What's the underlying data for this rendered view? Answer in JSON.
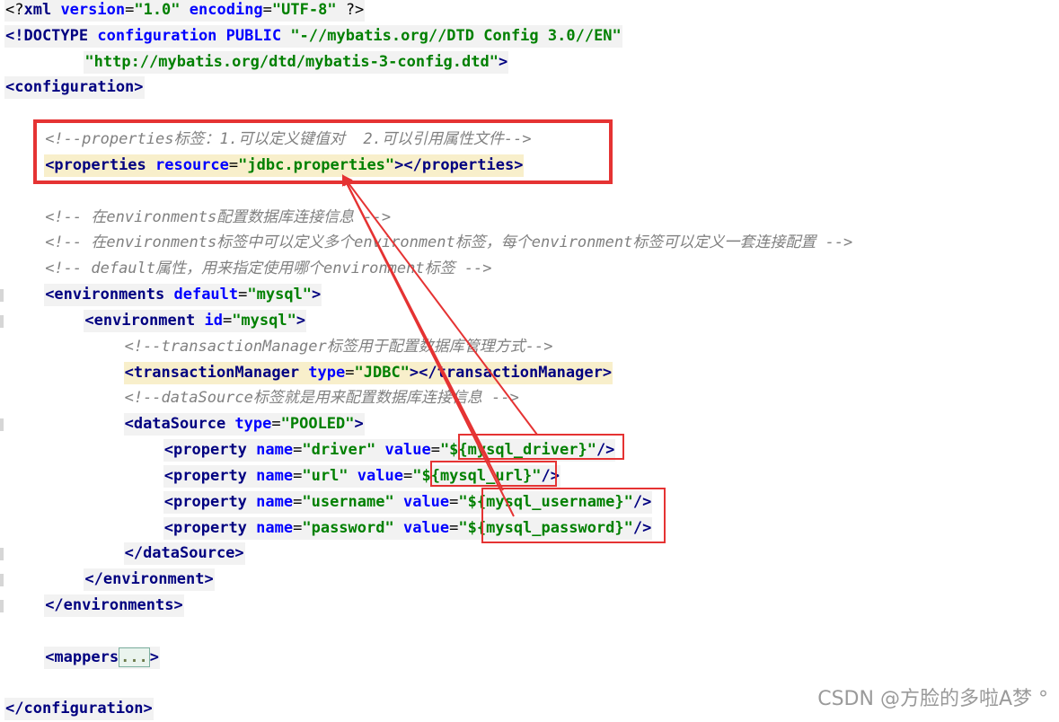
{
  "editor": {
    "lines": [
      {
        "indent": 0,
        "hl": "grey",
        "tokens": [
          {
            "t": "<?",
            "c": "pt"
          },
          {
            "t": "xml ",
            "c": "tb"
          },
          {
            "t": "version",
            "c": "an"
          },
          {
            "t": "=",
            "c": "pt"
          },
          {
            "t": "\"1.0\"",
            "c": "av"
          },
          {
            "t": " ",
            "c": "pt"
          },
          {
            "t": "encoding",
            "c": "an"
          },
          {
            "t": "=",
            "c": "pt"
          },
          {
            "t": "\"UTF-8\"",
            "c": "av"
          },
          {
            "t": " ?>",
            "c": "pt"
          }
        ]
      },
      {
        "indent": 0,
        "hl": "grey",
        "tokens": [
          {
            "t": "<!DOCTYPE ",
            "c": "tb"
          },
          {
            "t": "configuration ",
            "c": "an"
          },
          {
            "t": "PUBLIC ",
            "c": "an"
          },
          {
            "t": "\"-//mybatis.org//DTD Config 3.0//EN\"",
            "c": "av"
          }
        ]
      },
      {
        "indent": 8,
        "hl": "grey",
        "tokens": [
          {
            "t": "\"http://mybatis.org/dtd/mybatis-3-config.dtd\"",
            "c": "av"
          },
          {
            "t": ">",
            "c": "tb"
          }
        ]
      },
      {
        "indent": 0,
        "hl": "grey",
        "tokens": [
          {
            "t": "<configuration>",
            "c": "tb"
          }
        ]
      },
      {
        "indent": 0,
        "hl": "none",
        "tokens": []
      },
      {
        "indent": 4,
        "hl": "none",
        "tokens": [
          {
            "t": "<!--properties标签：1.可以定义键值对  2.可以引用属性文件-->",
            "c": "cm"
          }
        ]
      },
      {
        "indent": 4,
        "hl": "yellow",
        "tokens": [
          {
            "t": "<properties ",
            "c": "tb"
          },
          {
            "t": "resource",
            "c": "an"
          },
          {
            "t": "=",
            "c": "pt"
          },
          {
            "t": "\"jdbc.properties\"",
            "c": "av"
          },
          {
            "t": "></properties>",
            "c": "tb"
          }
        ]
      },
      {
        "indent": 0,
        "hl": "none",
        "tokens": []
      },
      {
        "indent": 4,
        "hl": "none",
        "tokens": [
          {
            "t": "<!-- 在environments配置数据库连接信息 -->",
            "c": "cm"
          }
        ]
      },
      {
        "indent": 4,
        "hl": "none",
        "tokens": [
          {
            "t": "<!-- 在environments标签中可以定义多个environment标签，每个environment标签可以定义一套连接配置 -->",
            "c": "cm"
          }
        ]
      },
      {
        "indent": 4,
        "hl": "none",
        "tokens": [
          {
            "t": "<!-- default属性，用来指定使用哪个environment标签 -->",
            "c": "cm"
          }
        ]
      },
      {
        "indent": 4,
        "hl": "grey",
        "tokens": [
          {
            "t": "<environments ",
            "c": "tb"
          },
          {
            "t": "default",
            "c": "an"
          },
          {
            "t": "=",
            "c": "pt"
          },
          {
            "t": "\"mysql\"",
            "c": "av"
          },
          {
            "t": ">",
            "c": "tb"
          }
        ]
      },
      {
        "indent": 8,
        "hl": "grey",
        "tokens": [
          {
            "t": "<environment ",
            "c": "tb"
          },
          {
            "t": "id",
            "c": "an"
          },
          {
            "t": "=",
            "c": "pt"
          },
          {
            "t": "\"mysql\"",
            "c": "av"
          },
          {
            "t": ">",
            "c": "tb"
          }
        ]
      },
      {
        "indent": 12,
        "hl": "none",
        "tokens": [
          {
            "t": "<!--transactionManager标签用于配置数据库管理方式-->",
            "c": "cm"
          }
        ]
      },
      {
        "indent": 12,
        "hl": "yellow",
        "tokens": [
          {
            "t": "<transactionManager ",
            "c": "tb"
          },
          {
            "t": "type",
            "c": "an"
          },
          {
            "t": "=",
            "c": "pt"
          },
          {
            "t": "\"JDBC\"",
            "c": "av"
          },
          {
            "t": "></transactionManager>",
            "c": "tb"
          }
        ]
      },
      {
        "indent": 12,
        "hl": "none",
        "tokens": [
          {
            "t": "<!--dataSource标签就是用来配置数据库连接信息 -->",
            "c": "cm"
          }
        ]
      },
      {
        "indent": 12,
        "hl": "grey",
        "tokens": [
          {
            "t": "<dataSource ",
            "c": "tb"
          },
          {
            "t": "type",
            "c": "an"
          },
          {
            "t": "=",
            "c": "pt"
          },
          {
            "t": "\"POOLED\"",
            "c": "av"
          },
          {
            "t": ">",
            "c": "tb"
          }
        ]
      },
      {
        "indent": 16,
        "hl": "grey",
        "tokens": [
          {
            "t": "<property ",
            "c": "tb"
          },
          {
            "t": "name",
            "c": "an"
          },
          {
            "t": "=",
            "c": "pt"
          },
          {
            "t": "\"driver\"",
            "c": "av"
          },
          {
            "t": " ",
            "c": "pt"
          },
          {
            "t": "value",
            "c": "an"
          },
          {
            "t": "=",
            "c": "pt"
          },
          {
            "t": "\"${mysql_driver}\"",
            "c": "av"
          },
          {
            "t": "/>",
            "c": "tb"
          }
        ]
      },
      {
        "indent": 16,
        "hl": "grey",
        "tokens": [
          {
            "t": "<property ",
            "c": "tb"
          },
          {
            "t": "name",
            "c": "an"
          },
          {
            "t": "=",
            "c": "pt"
          },
          {
            "t": "\"url\"",
            "c": "av"
          },
          {
            "t": " ",
            "c": "pt"
          },
          {
            "t": "value",
            "c": "an"
          },
          {
            "t": "=",
            "c": "pt"
          },
          {
            "t": "\"${mysql_url}\"",
            "c": "av"
          },
          {
            "t": "/>",
            "c": "tb"
          }
        ]
      },
      {
        "indent": 16,
        "hl": "grey",
        "tokens": [
          {
            "t": "<property ",
            "c": "tb"
          },
          {
            "t": "name",
            "c": "an"
          },
          {
            "t": "=",
            "c": "pt"
          },
          {
            "t": "\"username\"",
            "c": "av"
          },
          {
            "t": " ",
            "c": "pt"
          },
          {
            "t": "value",
            "c": "an"
          },
          {
            "t": "=",
            "c": "pt"
          },
          {
            "t": "\"${mysql_username}\"",
            "c": "av"
          },
          {
            "t": "/>",
            "c": "tb"
          }
        ]
      },
      {
        "indent": 16,
        "hl": "grey",
        "tokens": [
          {
            "t": "<property ",
            "c": "tb"
          },
          {
            "t": "name",
            "c": "an"
          },
          {
            "t": "=",
            "c": "pt"
          },
          {
            "t": "\"password\"",
            "c": "av"
          },
          {
            "t": " ",
            "c": "pt"
          },
          {
            "t": "value",
            "c": "an"
          },
          {
            "t": "=",
            "c": "pt"
          },
          {
            "t": "\"${mysql_password}\"",
            "c": "av"
          },
          {
            "t": "/>",
            "c": "tb"
          }
        ]
      },
      {
        "indent": 12,
        "hl": "grey",
        "tokens": [
          {
            "t": "</dataSource>",
            "c": "tb"
          }
        ]
      },
      {
        "indent": 8,
        "hl": "grey",
        "tokens": [
          {
            "t": "</environment>",
            "c": "tb"
          }
        ]
      },
      {
        "indent": 4,
        "hl": "grey",
        "tokens": [
          {
            "t": "</environments>",
            "c": "tb"
          }
        ]
      },
      {
        "indent": 0,
        "hl": "none",
        "tokens": []
      },
      {
        "indent": 4,
        "hl": "grey",
        "tokens": [
          {
            "t": "<mappers",
            "c": "tb"
          },
          {
            "t": "...",
            "c": "folded"
          },
          {
            "t": ">",
            "c": "tb"
          }
        ]
      },
      {
        "indent": 0,
        "hl": "none",
        "tokens": []
      },
      {
        "indent": 0,
        "hl": "grey",
        "tokens": [
          {
            "t": "</configuration>",
            "c": "tb"
          }
        ]
      }
    ]
  },
  "annotation": {
    "color": "#e53333"
  },
  "watermark": {
    "text": "CSDN @方脸的多啦A梦 °"
  }
}
